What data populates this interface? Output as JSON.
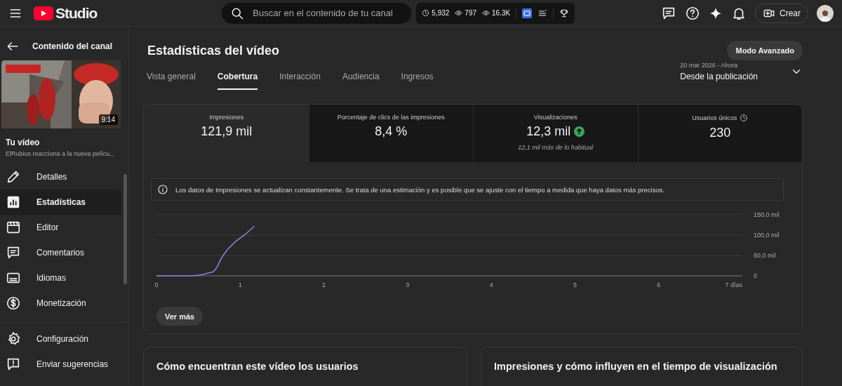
{
  "header": {
    "logo": "Studio",
    "search": {
      "placeholder": "Buscar en el contenido de tu canal"
    },
    "stats": [
      "5,932",
      "797",
      "16.3K"
    ],
    "create_button": "Crear"
  },
  "sidebar": {
    "back_label": "Contenido del canal",
    "video": {
      "duration": "9:14",
      "title": "Tu vídeo",
      "subtitle": "ElRubius reacciona a la nueva pelícu..."
    },
    "items": [
      {
        "label": "Detalles",
        "selected": false
      },
      {
        "label": "Estadísticas",
        "selected": true
      },
      {
        "label": "Editor",
        "selected": false
      },
      {
        "label": "Comentarios",
        "selected": false
      },
      {
        "label": "Idiomas",
        "selected": false
      },
      {
        "label": "Monetización",
        "selected": false
      }
    ],
    "footer_items": [
      {
        "label": "Configuración"
      },
      {
        "label": "Enviar sugerencias"
      }
    ]
  },
  "page": {
    "title": "Estadísticas del vídeo",
    "advanced_button": "Modo Avanzado",
    "tabs": [
      {
        "label": "Vista general",
        "selected": false
      },
      {
        "label": "Cobertura",
        "selected": true
      },
      {
        "label": "Interacción",
        "selected": false
      },
      {
        "label": "Audiencia",
        "selected": false
      },
      {
        "label": "Ingresos",
        "selected": false
      }
    ],
    "date_range": {
      "range": "20 mar 2026 - Ahora",
      "label": "Desde la publicación"
    },
    "metrics": [
      {
        "label": "Impresiones",
        "value": "121,9 mil",
        "selected": true
      },
      {
        "label": "Porcentaje de clics de las impresiones",
        "value": "8,4 %",
        "selected": false
      },
      {
        "label": "Visualizaciones",
        "value": "12,3 mil",
        "above_usual": true,
        "note": "12,1 mil más de lo habitual",
        "selected": false
      },
      {
        "label": "Usuarios únicos",
        "value": "230",
        "clock": true,
        "selected": false
      }
    ],
    "info": "Los datos de Impresiones se actualizan constantemente. Se trata de una estimación y es posible que se ajuste con el tiempo a medida que haya datos más precisos.",
    "chart_data": {
      "type": "line",
      "x": [
        0,
        0.45,
        0.55,
        0.62,
        0.68,
        0.72,
        0.78,
        0.85,
        0.95,
        1.05,
        1.17
      ],
      "series": [
        {
          "color": "#8c7fe8",
          "values": [
            0,
            0,
            3,
            7,
            10,
            20,
            45,
            65,
            85,
            100,
            122
          ]
        }
      ],
      "xlim": [
        0,
        7
      ],
      "ylim": [
        0,
        150
      ],
      "xticks": [
        0,
        1,
        2,
        3,
        4,
        5,
        6,
        {
          "value": 7,
          "label": "7 días"
        }
      ],
      "yticks": [
        0,
        {
          "value": 50,
          "label": "50,0 mil"
        },
        {
          "value": 100,
          "label": "100,0 mil"
        },
        {
          "value": 150,
          "label": "150,0 mil"
        }
      ]
    },
    "more_button": "Ver más",
    "bottom_cards": [
      "Cómo encuentran este vídeo los usuarios",
      "Impresiones y cómo influyen en el tiempo de visualización"
    ]
  }
}
